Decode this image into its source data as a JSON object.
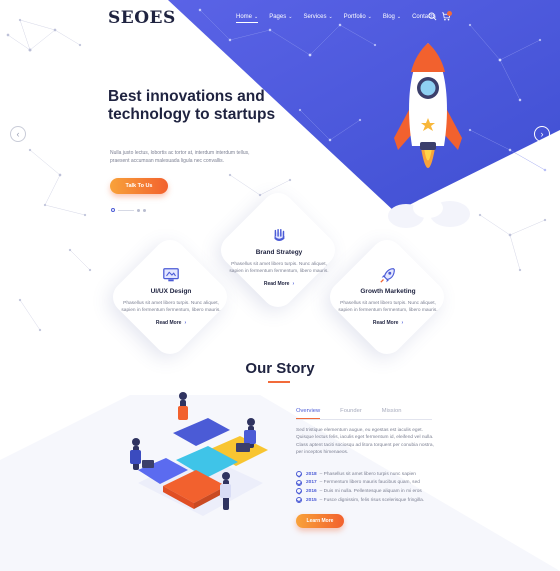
{
  "header": {
    "logo": "SEOES",
    "nav": [
      {
        "label": "Home",
        "caret": "⌄",
        "active": true
      },
      {
        "label": "Pages",
        "caret": "⌄"
      },
      {
        "label": "Services",
        "caret": "⌄"
      },
      {
        "label": "Portfolio",
        "caret": "⌄"
      },
      {
        "label": "Blog",
        "caret": "⌄"
      },
      {
        "label": "Contacts",
        "caret": ""
      }
    ]
  },
  "hero": {
    "title": "Best innovations and technology to startups",
    "text": "Nulla justo lectus, lobortis ac tortor at, interdum interdum tellus, praesent accumsan malesuada ligula nec convallis.",
    "button": "Talk To Us",
    "prev_arrow": "‹",
    "next_arrow": "›"
  },
  "services": [
    {
      "title": "Brand Strategy",
      "text": "Phasellus sit amet libero turpis. Nunc aliquet, sapien in fermentum fermentum, libero mauris.",
      "more": "Read More",
      "chev": "›",
      "icon": "brand-strategy-icon"
    },
    {
      "title": "UI/UX Design",
      "text": "Phasellus sit amet libero turpis. Nunc aliquet, sapien in fermentum fermentum, libero mauris.",
      "more": "Read More",
      "chev": "›",
      "icon": "ui-ux-icon"
    },
    {
      "title": "Growth Marketing",
      "text": "Phasellus sit amet libero turpis. Nunc aliquet, sapien in fermentum fermentum, libero mauris.",
      "more": "Read More",
      "chev": "›",
      "icon": "rocket-icon"
    }
  ],
  "story": {
    "title": "Our Story",
    "tabs": [
      "Overview",
      "Founder",
      "Mission"
    ],
    "text": "Sed tristique elementum augue, eu egestas est iaculis eget. Quisque lectus felis, iaculis eget fermentum id, eleifend vel nulla. Class aptent taciti sociosqu ad litora torquent per conubia nostra, per inceptos himenaeos.",
    "timeline": [
      {
        "year": "2018",
        "text": "– Phasellus sit amet libero turpis nunc sapien"
      },
      {
        "year": "2017",
        "text": "– Fermentum libero mauris faucibus quam, sed"
      },
      {
        "year": "2016",
        "text": "– Duis mi nulla. Pellentesque aliquam in mi eros"
      },
      {
        "year": "2015",
        "text": "– Fusce dignissim, felis risus scelerisque fringilla."
      }
    ],
    "button": "Learn More"
  },
  "colors": {
    "primary": "#4b5bd6",
    "accent": "#f26b3a",
    "dark": "#1f2340"
  }
}
